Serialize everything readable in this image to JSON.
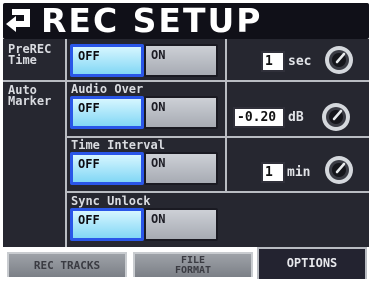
{
  "title": "REC SETUP",
  "prerec": {
    "label_line1": "PreREC",
    "label_line2": "Time",
    "off_label": "OFF",
    "on_label": "ON",
    "value": "1",
    "unit": "sec"
  },
  "auto_marker": {
    "label_line1": "Auto",
    "label_line2": "Marker",
    "audio_over": {
      "label": "Audio Over",
      "off_label": "OFF",
      "on_label": "ON",
      "value": "-0.20",
      "unit": "dB"
    },
    "time_interval": {
      "label": "Time Interval",
      "off_label": "OFF",
      "on_label": "ON",
      "value": "1",
      "unit": "min"
    },
    "sync_unlock": {
      "label": "Sync Unlock",
      "off_label": "OFF",
      "on_label": "ON"
    }
  },
  "tabs": [
    {
      "label": "REC TRACKS"
    },
    {
      "label_line1": "FILE",
      "label_line2": "FORMAT"
    },
    {
      "label": "OPTIONS"
    }
  ],
  "icons": {
    "back": "back-arrow-icon",
    "dial": "dial-knob-icon"
  },
  "colors": {
    "selected_button": "#82d7f5",
    "selected_border": "#2a56e8",
    "panel_bg": "#262730"
  }
}
